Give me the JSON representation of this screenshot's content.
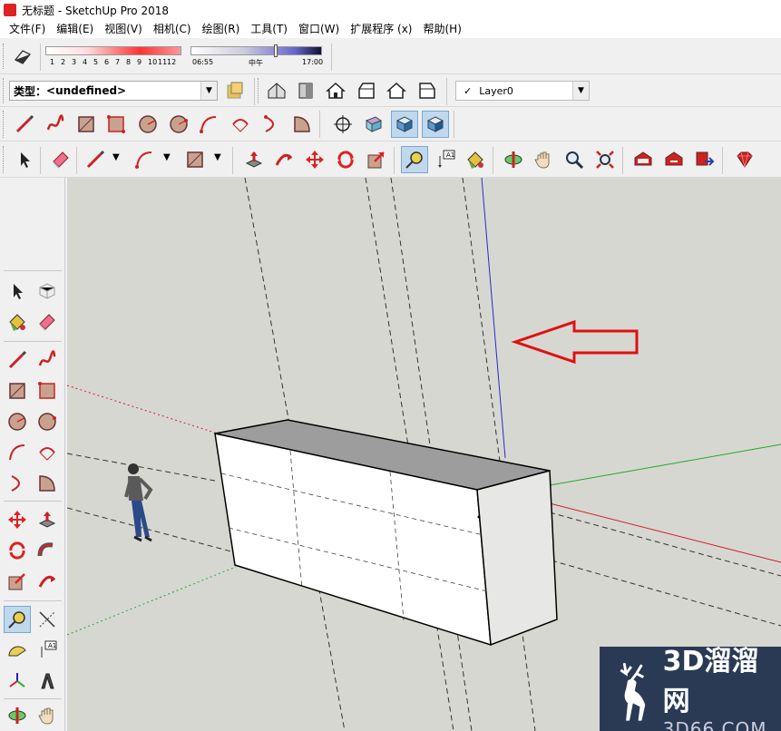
{
  "window": {
    "title": "无标题 - SketchUp Pro 2018"
  },
  "menu": [
    "文件(F)",
    "编辑(E)",
    "视图(V)",
    "相机(C)",
    "绘图(R)",
    "工具(T)",
    "窗口(W)",
    "扩展程序 (x)",
    "帮助(H)"
  ],
  "shadow": {
    "months": [
      "1",
      "2",
      "3",
      "4",
      "5",
      "6",
      "7",
      "8",
      "9",
      "10",
      "11",
      "12"
    ],
    "time_start": "06:55",
    "time_mid": "中午",
    "time_end": "17:00"
  },
  "type_combo": {
    "label": "类型：",
    "value": "<undefined>"
  },
  "layer_combo": {
    "value": "Layer0",
    "check": "✓"
  },
  "tag": {
    "text": "A1"
  },
  "watermark": {
    "main": "3D溜溜网",
    "sub": "3D66.COM"
  },
  "colors": {
    "viewport_bg": "#d7d7d2",
    "axis_red": "#c22",
    "axis_green": "#2a2",
    "axis_blue": "#22c",
    "arrow": "#e01010"
  }
}
